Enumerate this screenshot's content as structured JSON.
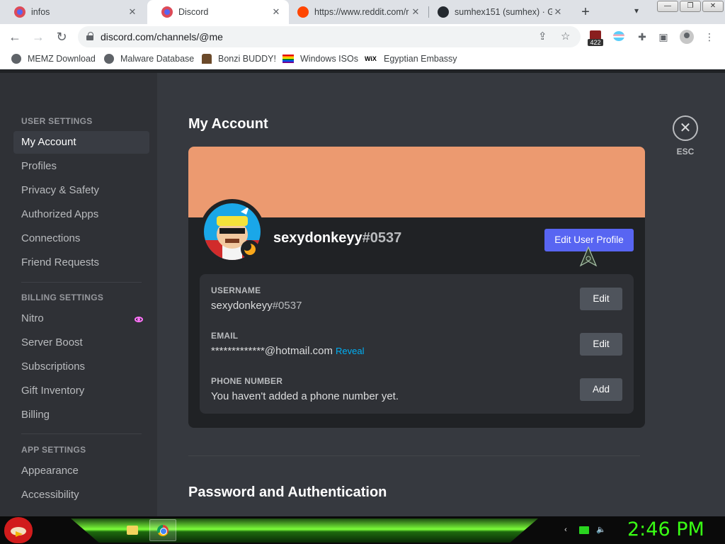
{
  "browser": {
    "tabs": [
      {
        "title": "infos",
        "icon": "discord-favicon"
      },
      {
        "title": "Discord",
        "icon": "discord-favicon"
      },
      {
        "title": "https://www.reddit.com/r",
        "icon": "reddit-favicon"
      },
      {
        "title": "sumhex151 (sumhex) · Gi",
        "icon": "github-favicon"
      }
    ],
    "url": "discord.com/channels/@me",
    "extension_badge": "422",
    "bookmarks": [
      {
        "label": "MEMZ Download"
      },
      {
        "label": "Malware Database"
      },
      {
        "label": "Bonzi BUDDY!"
      },
      {
        "label": "Windows ISOs"
      },
      {
        "label": "Egyptian Embassy",
        "icon_text": "WiX"
      }
    ]
  },
  "sidebar": {
    "user_settings_header": "USER SETTINGS",
    "user_settings": [
      "My Account",
      "Profiles",
      "Privacy & Safety",
      "Authorized Apps",
      "Connections",
      "Friend Requests"
    ],
    "billing_settings_header": "BILLING SETTINGS",
    "billing_settings": [
      "Nitro",
      "Server Boost",
      "Subscriptions",
      "Gift Inventory",
      "Billing"
    ],
    "app_settings_header": "APP SETTINGS",
    "app_settings": [
      "Appearance",
      "Accessibility"
    ]
  },
  "account": {
    "page_title": "My Account",
    "banner_color": "#ec9a70",
    "display_name": "sexydonkeyy",
    "discriminator": "#0537",
    "edit_profile_button": "Edit User Profile",
    "fields": {
      "username_label": "USERNAME",
      "username_name": "sexydonkeyy",
      "username_disc": "#0537",
      "username_button": "Edit",
      "email_label": "EMAIL",
      "email_value": "*************@hotmail.com",
      "email_reveal": "Reveal",
      "email_button": "Edit",
      "phone_label": "PHONE NUMBER",
      "phone_value": "You haven't added a phone number yet.",
      "phone_button": "Add"
    },
    "section_title": "Password and Authentication",
    "esc_label": "ESC"
  },
  "taskbar": {
    "clock": "2:46 PM"
  },
  "colors": {
    "blurple": "#5865f2",
    "status_idle": "#faa81a",
    "link": "#00aff4"
  }
}
